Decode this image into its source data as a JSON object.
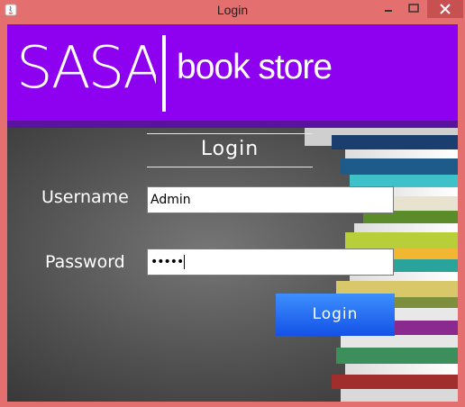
{
  "window": {
    "title": "Login",
    "controls": [
      "minimize-icon",
      "maximize-icon",
      "close-icon"
    ]
  },
  "banner": {
    "brand": "SASA",
    "subtitle": "book store",
    "color": "#8e00f0"
  },
  "form": {
    "heading": "Login",
    "username_label": "Username",
    "username_value": "Admin",
    "password_label": "Password",
    "password_mask": "•••••",
    "submit_label": "Login"
  },
  "colors": {
    "titlebar": "#e36f6f",
    "button": "#2a6ff5"
  }
}
